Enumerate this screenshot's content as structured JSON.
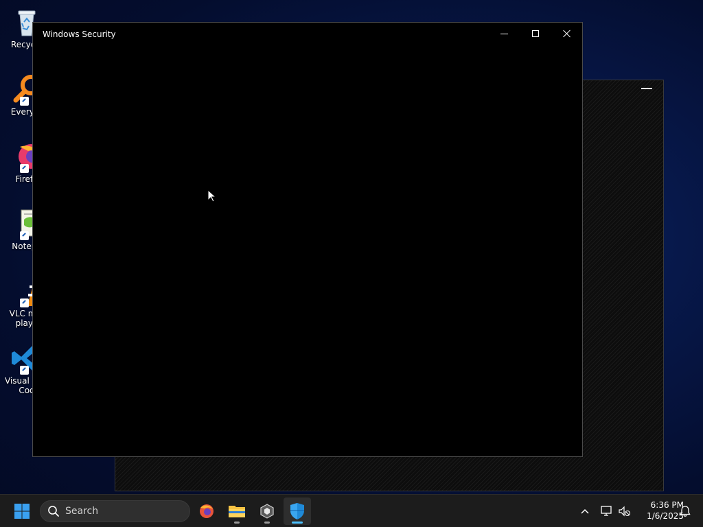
{
  "desktop": {
    "icons": [
      {
        "label": "Recycle",
        "icon": "recycle-bin-icon"
      },
      {
        "label": "Everyth",
        "icon": "everything-search-icon"
      },
      {
        "label": "Firefo",
        "icon": "firefox-icon"
      },
      {
        "label": "Notepa",
        "icon": "notepad-plus-plus-icon"
      },
      {
        "label": "VLC m… playe",
        "icon": "vlc-icon"
      },
      {
        "label": "Visual St… Cod",
        "icon": "vscode-icon"
      }
    ]
  },
  "window": {
    "title": "Windows Security",
    "minimize_icon": "minimize-icon",
    "maximize_icon": "maximize-icon",
    "close_icon": "close-icon"
  },
  "taskbar": {
    "search_placeholder": "Search",
    "apps": [
      {
        "name": "firefox",
        "icon": "firefox-icon",
        "active": false
      },
      {
        "name": "file-explorer",
        "icon": "folder-icon",
        "active": false
      },
      {
        "name": "app-3d",
        "icon": "cube-app-icon",
        "active": false
      },
      {
        "name": "windows-security",
        "icon": "shield-icon",
        "active": true
      }
    ],
    "time": "6:36 PM",
    "date": "1/6/2025"
  },
  "colors": {
    "accent": "#4cc2ff",
    "taskbar_bg": "#1c1c1c",
    "window_bg": "#000000"
  }
}
